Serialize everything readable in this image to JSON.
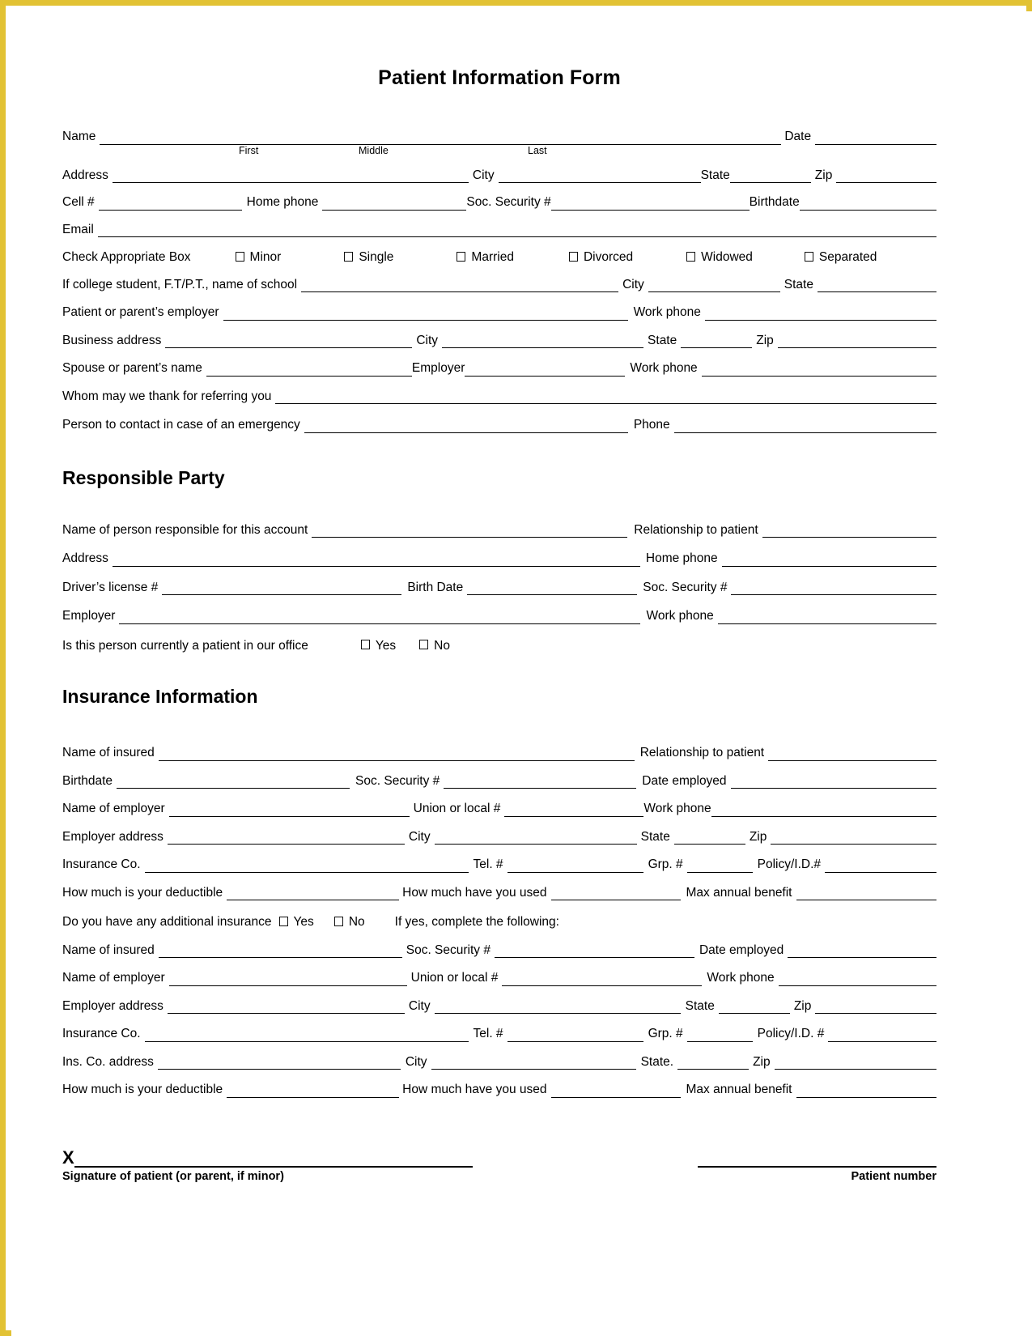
{
  "document": {
    "title": "Patient Information Form",
    "border_color": "#e2c234"
  },
  "patient_section": {
    "name_label": "Name",
    "name_sublabels": {
      "first": "First",
      "middle": "Middle",
      "last": "Last"
    },
    "date_label": "Date",
    "address_label": "Address",
    "city_label": "City",
    "state_label": "State",
    "zip_label": "Zip",
    "cell_label": "Cell #",
    "home_phone_label": "Home phone",
    "soc_security_label": "Soc. Security #",
    "birthdate_label": "Birthdate",
    "email_label": "Email",
    "check_box_label": "Check Appropriate Box",
    "marital_options": [
      "Minor",
      "Single",
      "Married",
      "Divorced",
      "Widowed",
      "Separated"
    ],
    "school_label": "If college student, F.T/P.T., name of school",
    "school_city_label": "City",
    "school_state_label": "State",
    "employer_label": "Patient or parent’s employer",
    "work_phone_label": "Work phone",
    "business_address_label": "Business address",
    "business_city_label": "City",
    "business_state_label": "State",
    "business_zip_label": "Zip",
    "spouse_label": "Spouse or parent’s name",
    "spouse_employer_label": "Employer",
    "spouse_work_phone_label": "Work phone",
    "referral_label": "Whom may we thank for referring you",
    "emergency_label": "Person to contact in case of an emergency",
    "emergency_phone_label": "Phone"
  },
  "responsible_party": {
    "heading": "Responsible Party",
    "name_label": "Name of person responsible for this account",
    "relationship_label": "Relationship to patient",
    "address_label": "Address",
    "home_phone_label": "Home phone",
    "drivers_license_label": "Driver’s license #",
    "birth_date_label": "Birth Date",
    "soc_security_label": "Soc. Security #",
    "employer_label": "Employer",
    "work_phone_label": "Work phone",
    "current_patient_label": "Is this person currently a patient in our office",
    "yes_label": "Yes",
    "no_label": "No"
  },
  "insurance": {
    "heading": "Insurance Information",
    "primary": {
      "name_insured_label": "Name of insured",
      "relationship_label": "Relationship to patient",
      "birthdate_label": "Birthdate",
      "soc_security_label": "Soc. Security #",
      "date_employed_label": "Date employed",
      "name_employer_label": "Name of employer",
      "union_label": "Union or local #",
      "work_phone_label": "Work phone",
      "employer_address_label": "Employer address",
      "city_label": "City",
      "state_label": "State",
      "zip_label": "Zip",
      "insurance_co_label": "Insurance Co.",
      "tel_label": "Tel. #",
      "grp_label": "Grp. #",
      "policy_label": "Policy/I.D.#",
      "deductible_label": "How much is your deductible",
      "used_label": "How much have you used",
      "max_benefit_label": "Max annual benefit"
    },
    "additional_question": {
      "label": "Do you have any additional insurance",
      "yes_label": "Yes",
      "no_label": "No",
      "if_yes_label": "If yes, complete the following:"
    },
    "secondary": {
      "name_insured_label": "Name of insured",
      "soc_security_label": "Soc. Security #",
      "date_employed_label": "Date employed",
      "name_employer_label": "Name of employer",
      "union_label": "Union or local #",
      "work_phone_label": "Work phone",
      "employer_address_label": "Employer address",
      "city_label": "City",
      "state_label": "State",
      "zip_label": "Zip",
      "insurance_co_label": "Insurance Co.",
      "tel_label": "Tel. #",
      "grp_label": "Grp. #",
      "policy_label": "Policy/I.D. #",
      "ins_co_address_label": "Ins. Co. address",
      "ins_co_city_label": "City",
      "ins_co_state_label": "State.",
      "ins_co_zip_label": "Zip",
      "deductible_label": "How much is your deductible",
      "used_label": "How much have you used",
      "max_benefit_label": "Max annual benefit"
    }
  },
  "footer": {
    "signature_mark": "X",
    "signature_caption": "Signature of patient (or parent, if minor)",
    "patient_number_caption": "Patient number"
  }
}
